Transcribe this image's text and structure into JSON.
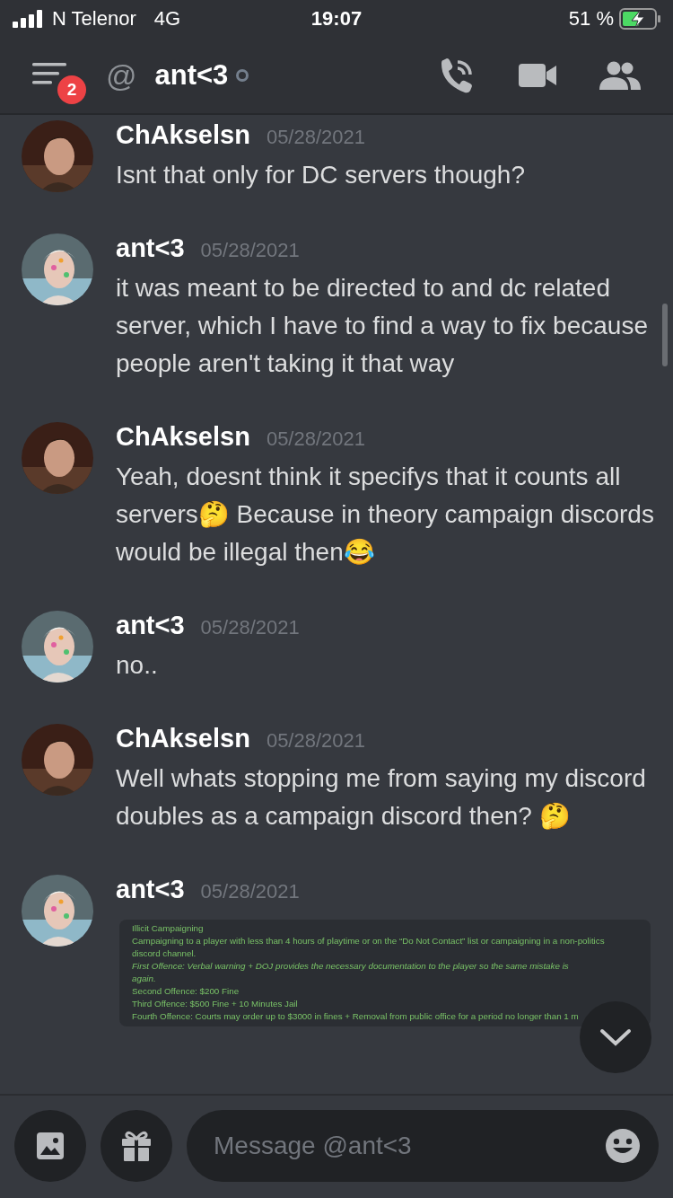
{
  "status_bar": {
    "carrier": "N Telenor",
    "network": "4G",
    "time": "19:07",
    "battery": "51 %"
  },
  "header": {
    "unread_count": "2",
    "at_sign": "@",
    "channel_name": "ant<3"
  },
  "messages": [
    {
      "author": "ChAkselsn",
      "timestamp": "05/28/2021",
      "text": "Isnt that only for DC servers though?"
    },
    {
      "author": "ant<3",
      "timestamp": "05/28/2021",
      "text": "it was meant to be directed to and dc related server, which I have to find a way to fix because people aren't taking it that way"
    },
    {
      "author": "ChAkselsn",
      "timestamp": "05/28/2021",
      "text": "Yeah, doesnt think it specifys that it counts all servers🤔 Because in theory campaign discords would be illegal then😂"
    },
    {
      "author": "ant<3",
      "timestamp": "05/28/2021",
      "text": "no.."
    },
    {
      "author": "ChAkselsn",
      "timestamp": "05/28/2021",
      "text": "Well whats stopping me from saying my discord doubles as a campaign discord then? 🤔"
    },
    {
      "author": "ant<3",
      "timestamp": "05/28/2021",
      "attachment": {
        "kind": "text-image",
        "lines": [
          {
            "text": "Illicit Campaigning",
            "italic": false
          },
          {
            "text": "Campaigning to a player with less than 4 hours of playtime or on the “Do Not Contact” list or campaigning in a non-politics",
            "italic": false
          },
          {
            "text": "discord channel.",
            "italic": false
          },
          {
            "text": "First Offence: Verbal warning + DOJ provides the necessary documentation to the player so the same mistake is",
            "italic": true
          },
          {
            "text": "again.",
            "italic": true
          },
          {
            "text": "Second Offence: $200 Fine",
            "italic": false
          },
          {
            "text": "Third Offence: $500 Fine + 10 Minutes Jail",
            "italic": false
          },
          {
            "text": "Fourth Offence: Courts may order up to $3000 in fines + Removal from public office for a period no longer than 1 m",
            "italic": false
          }
        ]
      }
    }
  ],
  "composer": {
    "placeholder": "Message @ant<3"
  }
}
